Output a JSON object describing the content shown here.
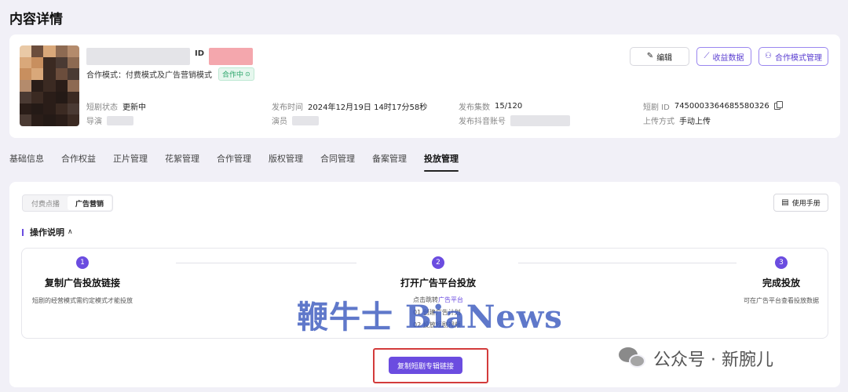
{
  "page": {
    "title": "内容详情"
  },
  "content_card": {
    "id_label": "ID",
    "mode_line": "合作模式：付费模式及广告营销模式",
    "status_tag": "合作中",
    "fields": {
      "status_key": "短剧状态",
      "status_val": "更新中",
      "director_key": "导演",
      "publish_time_key": "发布时间",
      "publish_time_val": "2024年12月19日 14时17分58秒",
      "actors_key": "演员",
      "episodes_key": "发布集数",
      "episodes_val": "15/120",
      "account_key": "发布抖音账号",
      "drama_id_key": "短剧 ID",
      "drama_id_val": "7450003364685580326",
      "upload_key": "上传方式",
      "upload_val": "手动上传"
    },
    "buttons": {
      "edit": "编辑",
      "income": "收益数据",
      "coop": "合作模式管理"
    }
  },
  "tabs": [
    "基础信息",
    "合作权益",
    "正片管理",
    "花絮管理",
    "合作管理",
    "版权管理",
    "合同管理",
    "备案管理",
    "投放管理"
  ],
  "active_tab": "投放管理",
  "panel": {
    "segments": [
      "付费点播",
      "广告营销"
    ],
    "active_segment": "广告营销",
    "manual_button": "使用手册",
    "section_title": "操作说明",
    "steps": [
      {
        "num": "1",
        "title": "复制广告投放链接",
        "desc": "短剧的经营模式需约定模式才能投放"
      },
      {
        "num": "2",
        "title": "打开广告平台投放",
        "line1_pre": "点击跳转",
        "line1_link": "广告平台",
        "line2": "01 创建广告计划",
        "line3": "02 投放短剧视频"
      },
      {
        "num": "3",
        "title": "完成投放",
        "desc": "可在广告平台查看投放数据"
      }
    ],
    "copy_link_button": "复制短剧专辑链接"
  },
  "overlays": {
    "watermark": "鞭牛士 BiaNews",
    "wechat": "公众号 · 新腕儿"
  }
}
